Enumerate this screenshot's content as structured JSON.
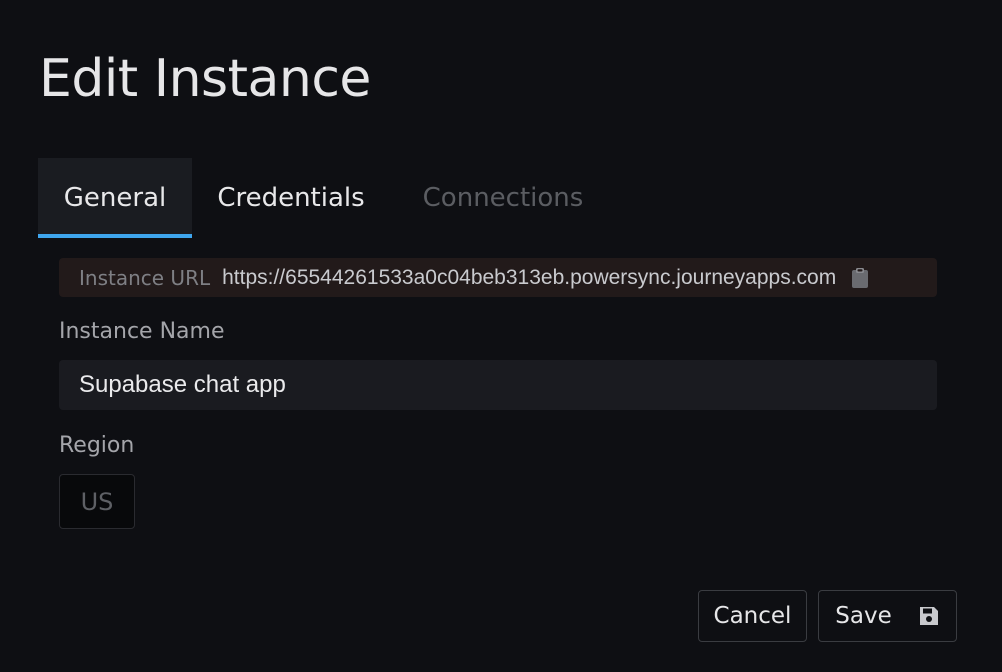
{
  "page": {
    "title": "Edit Instance"
  },
  "tabs": [
    {
      "label": "General",
      "state": "active"
    },
    {
      "label": "Credentials",
      "state": "normal"
    },
    {
      "label": "Connections",
      "state": "disabled"
    }
  ],
  "instance_url": {
    "label": "Instance URL",
    "value": "https://65544261533a0c04beb313eb.powersync.journeyapps.com",
    "icon": "clipboard-icon"
  },
  "instance_name": {
    "label": "Instance Name",
    "value": "Supabase chat app"
  },
  "region": {
    "label": "Region",
    "value": "US"
  },
  "actions": {
    "cancel_label": "Cancel",
    "save_label": "Save",
    "save_icon": "floppy-disk-icon"
  },
  "colors": {
    "background": "#0e0f13",
    "accent": "#3fa6ee",
    "url_bar": "#221a1a"
  }
}
